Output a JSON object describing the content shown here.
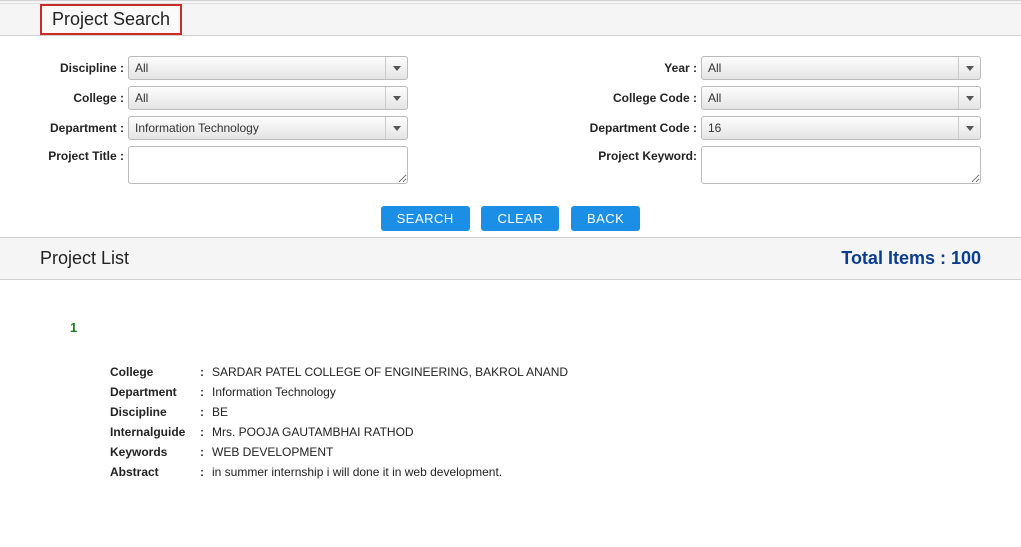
{
  "header": {
    "title": "Project Search"
  },
  "form": {
    "discipline_label": "Discipline :",
    "discipline_value": "All",
    "year_label": "Year :",
    "year_value": "All",
    "college_label": "College :",
    "college_value": "All",
    "college_code_label": "College Code :",
    "college_code_value": "All",
    "department_label": "Department :",
    "department_value": "Information Technology",
    "department_code_label": "Department Code :",
    "department_code_value": "16",
    "project_title_label": "Project Title :",
    "project_title_value": "",
    "project_keyword_label": "Project Keyword:",
    "project_keyword_value": ""
  },
  "buttons": {
    "search": "SEARCH",
    "clear": "CLEAR",
    "back": "BACK"
  },
  "list": {
    "title": "Project List",
    "total_label": "Total Items : 100"
  },
  "result": {
    "index": "1",
    "rows": {
      "college_k": "College",
      "college_v": "SARDAR PATEL COLLEGE OF ENGINEERING, BAKROL ANAND",
      "department_k": "Department",
      "department_v": "Information Technology",
      "discipline_k": "Discipline",
      "discipline_v": "BE",
      "guide_k": "Internalguide",
      "guide_v": "Mrs. POOJA GAUTAMBHAI RATHOD",
      "keywords_k": "Keywords",
      "keywords_v": "WEB DEVELOPMENT",
      "abstract_k": "Abstract",
      "abstract_v": "in summer internship i will done it in web development."
    }
  }
}
